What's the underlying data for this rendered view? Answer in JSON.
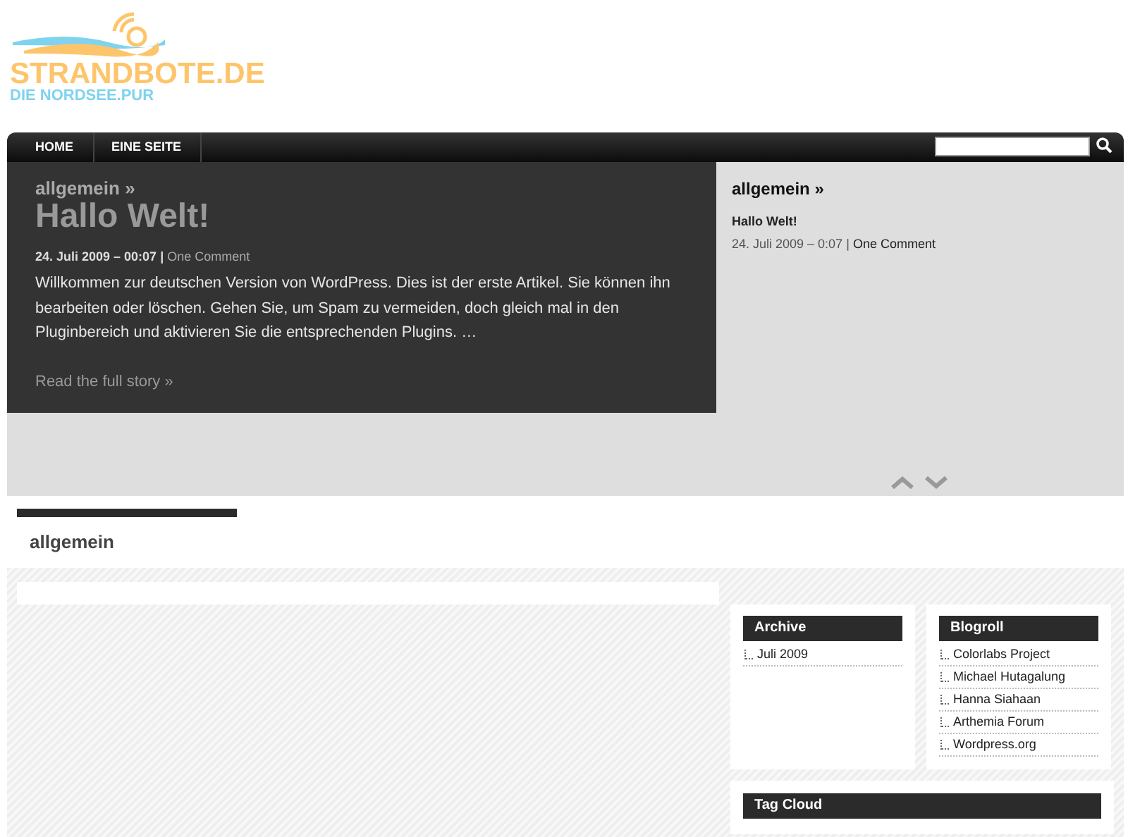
{
  "logo": {
    "title": "STRANDBOTE.DE",
    "tagline": "DIE NORDSEE.PUR"
  },
  "nav": [
    {
      "label": "HOME"
    },
    {
      "label": "EINE SEITE"
    }
  ],
  "featured": {
    "category": "allgemein »",
    "title": "Hallo Welt!",
    "date": "24. Juli 2009 – 00:07",
    "separator": "|",
    "comments": "One Comment",
    "excerpt": "Willkommen zur deutschen Version von WordPress. Dies ist der erste Artikel. Sie können ihn bearbeiten oder löschen. Gehen Sie, um Spam zu vermeiden, doch gleich mal in den Pluginbereich und aktivieren Sie die entsprechenden Plugins. …",
    "read_more": "Read the full story »"
  },
  "featured_list": {
    "category": "allgemein »",
    "items": [
      {
        "title": "Hallo Welt!",
        "date": "24. Juli 2009 – 0:07",
        "separator": "|",
        "comments": "One Comment"
      }
    ]
  },
  "section_title": "allgemein",
  "widgets": [
    {
      "title": "Archive",
      "items": [
        "Juli 2009"
      ]
    },
    {
      "title": "Blogroll",
      "items": [
        "Colorlabs Project",
        "Michael Hutagalung",
        "Hanna Siahaan",
        "Arthemia Forum",
        "Wordpress.org"
      ]
    },
    {
      "title": "Tag Cloud"
    }
  ]
}
